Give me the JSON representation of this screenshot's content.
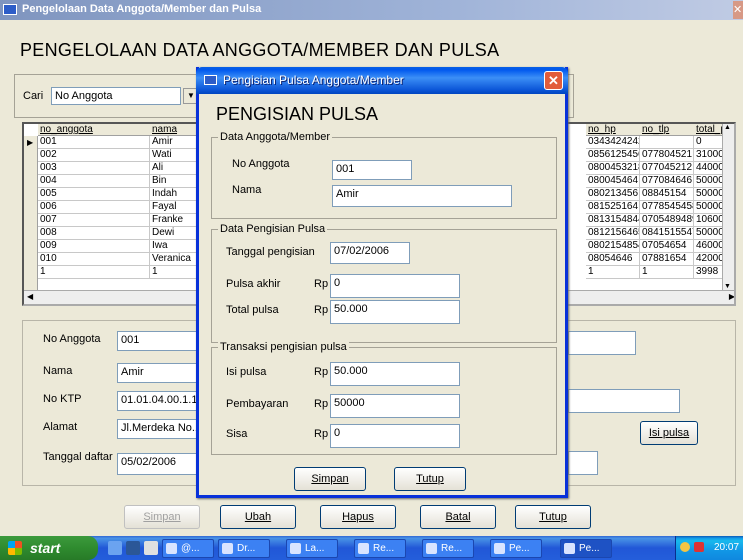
{
  "window": {
    "title": "Pengelolaan Data Anggota/Member dan Pulsa"
  },
  "main": {
    "heading": "PENGELOLAAN DATA ANGGOTA/MEMBER DAN PULSA",
    "search": {
      "label": "Cari",
      "selected": "No Anggota"
    },
    "grid": {
      "columns": [
        "no_anggota",
        "nama",
        "no_hp",
        "no_tlp",
        "total_pi"
      ],
      "rows": [
        [
          "001",
          "Amir",
          "0343424242",
          "",
          "0"
        ],
        [
          "002",
          "Wati",
          "0856125456",
          "077804521",
          "31000"
        ],
        [
          "003",
          "Ali",
          "0800453218",
          "077045212",
          "44000"
        ],
        [
          "004",
          "Bin",
          "080045464",
          "077084646",
          "50000"
        ],
        [
          "005",
          "Indah",
          "080213456",
          "08845154",
          "50000"
        ],
        [
          "006",
          "Fayal",
          "081525164",
          "0778545458",
          "50000"
        ],
        [
          "007",
          "Franke",
          "0813154844",
          "0705489489",
          "106000"
        ],
        [
          "008",
          "Dewi",
          "0812156465",
          "0841515547",
          "50000"
        ],
        [
          "009",
          "Iwa",
          "0802154854",
          "07054654",
          "46000"
        ],
        [
          "010",
          "Veranica",
          "08054646",
          "07881654",
          "42000"
        ],
        [
          "1",
          "1",
          "1",
          "1",
          "3998"
        ]
      ]
    },
    "form": {
      "no_anggota_label": "No Anggota",
      "no_anggota_value": "001",
      "nama_label": "Nama",
      "nama_value": "Amir",
      "no_ktp_label": "No KTP",
      "no_ktp_value": "01.01.04.00.1.11",
      "alamat_label": "Alamat",
      "alamat_value": "Jl.Merdeka No.11",
      "tanggal_label": "Tanggal daftar",
      "tanggal_value": "05/02/2006",
      "isi_pulsa_button": "Isi pulsa"
    },
    "buttons": {
      "simpan": "Simpan",
      "ubah": "Ubah",
      "hapus": "Hapus",
      "batal": "Batal",
      "tutup": "Tutup"
    }
  },
  "dialog": {
    "title": "Pengisian Pulsa Anggota/Member",
    "heading": "PENGISIAN PULSA",
    "group_member": "Data Anggota/Member",
    "no_anggota_label": "No Anggota",
    "no_anggota_value": "001",
    "nama_label": "Nama",
    "nama_value": "Amir",
    "group_pengisian": "Data Pengisian Pulsa",
    "tanggal_label": "Tanggal pengisian",
    "tanggal_value": "07/02/2006",
    "pulsa_akhir_label": "Pulsa akhir",
    "pulsa_akhir_currency": "Rp",
    "pulsa_akhir_value": "0",
    "total_pulsa_label": "Total pulsa",
    "total_pulsa_currency": "Rp",
    "total_pulsa_value": "50.000",
    "group_transaksi": "Transaksi pengisian pulsa",
    "isi_pulsa_label": "Isi pulsa",
    "isi_pulsa_currency": "Rp",
    "isi_pulsa_value": "50.000",
    "pembayaran_label": "Pembayaran",
    "pembayaran_currency": "Rp",
    "pembayaran_value": "50000",
    "sisa_label": "Sisa",
    "sisa_currency": "Rp",
    "sisa_value": "0",
    "simpan_button": "Simpan",
    "tutup_button": "Tutup"
  },
  "taskbar": {
    "start_label": "start",
    "items": [
      "@...",
      "Dr...",
      "La...",
      "Re...",
      "Re...",
      "Pe...",
      "Pe..."
    ],
    "clock": "20:07"
  }
}
